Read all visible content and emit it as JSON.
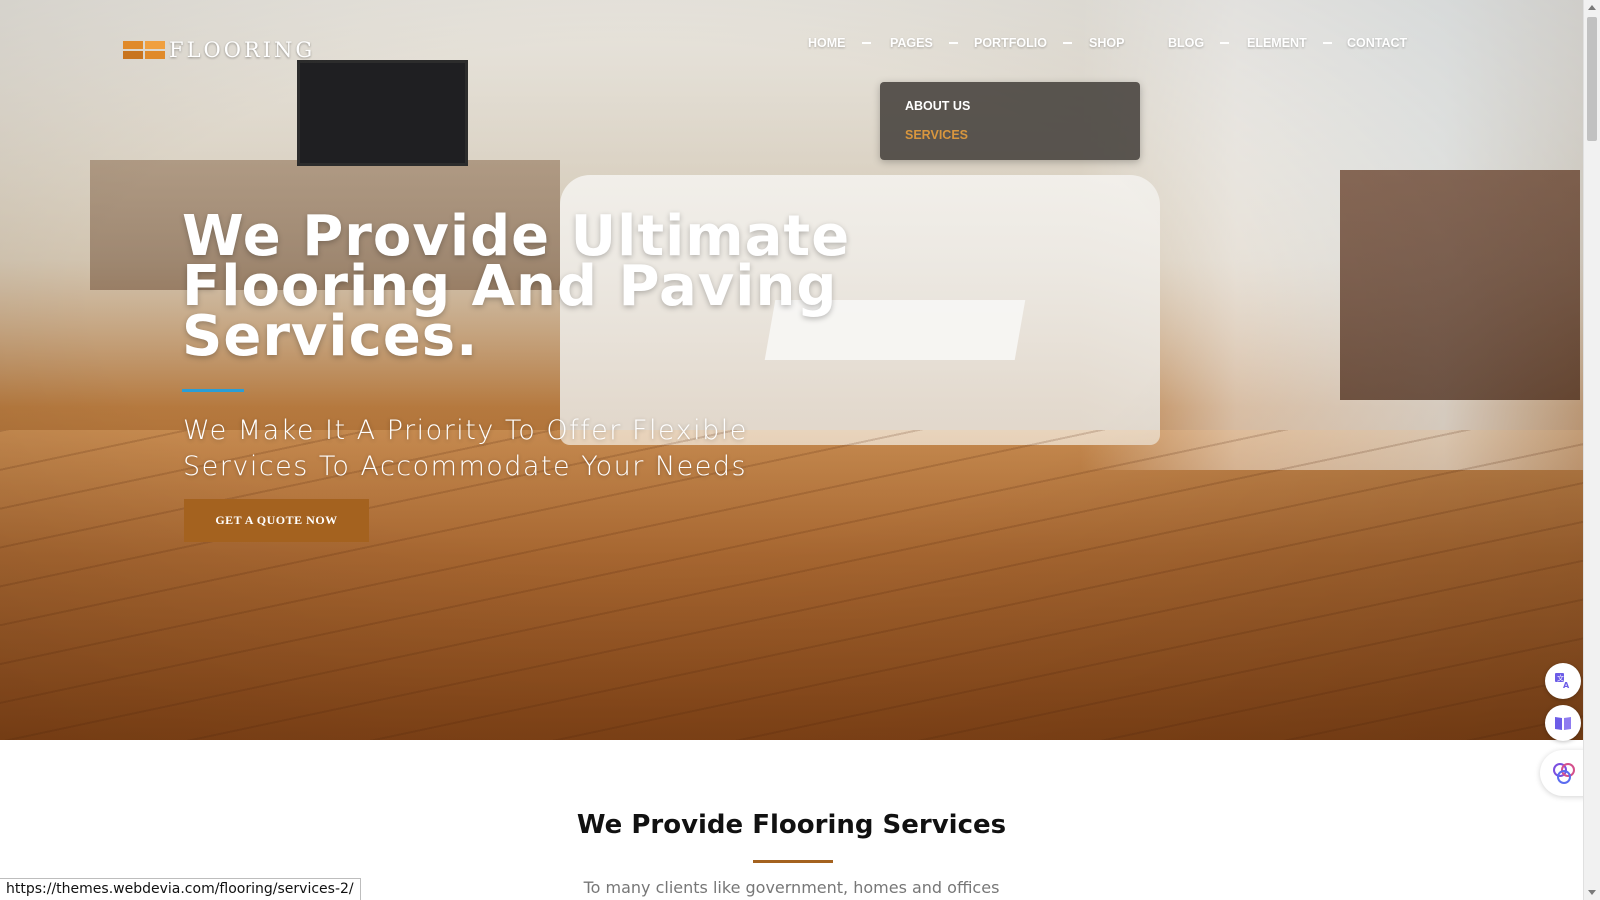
{
  "header": {
    "logo_text": "FLOORING",
    "nav": [
      {
        "label": "HOME",
        "has_dropdown": true
      },
      {
        "label": "PAGES",
        "has_dropdown": true
      },
      {
        "label": "PORTFOLIO",
        "has_dropdown": true
      },
      {
        "label": "SHOP",
        "has_dropdown": false
      },
      {
        "label": "BLOG",
        "has_dropdown": true
      },
      {
        "label": "ELEMENT",
        "has_dropdown": true
      },
      {
        "label": "CONTACT",
        "has_dropdown": false
      }
    ],
    "dropdown": {
      "items": [
        {
          "label": "ABOUT US",
          "active": false
        },
        {
          "label": "SERVICES",
          "active": true
        }
      ]
    }
  },
  "hero": {
    "title": "We Provide Ultimate Flooring And Paving Services.",
    "subtitle": "We Make It A Priority To Offer Flexible Services To Accommodate Your Needs",
    "cta_label": "GET A QUOTE NOW"
  },
  "section": {
    "title": "We Provide Flooring Services",
    "subtitle": "To many clients like government, homes and offices"
  },
  "status_bar": {
    "url": "https://themes.webdevia.com/flooring/services-2/"
  },
  "widgets": {
    "icons": [
      "translate-icon",
      "reader-icon",
      "brain-icon"
    ]
  },
  "colors": {
    "accent_brown": "#a4621f",
    "accent_blue": "#2a9ed6",
    "active_menu": "#d8963e",
    "logo_orange": "#e08a2a"
  }
}
